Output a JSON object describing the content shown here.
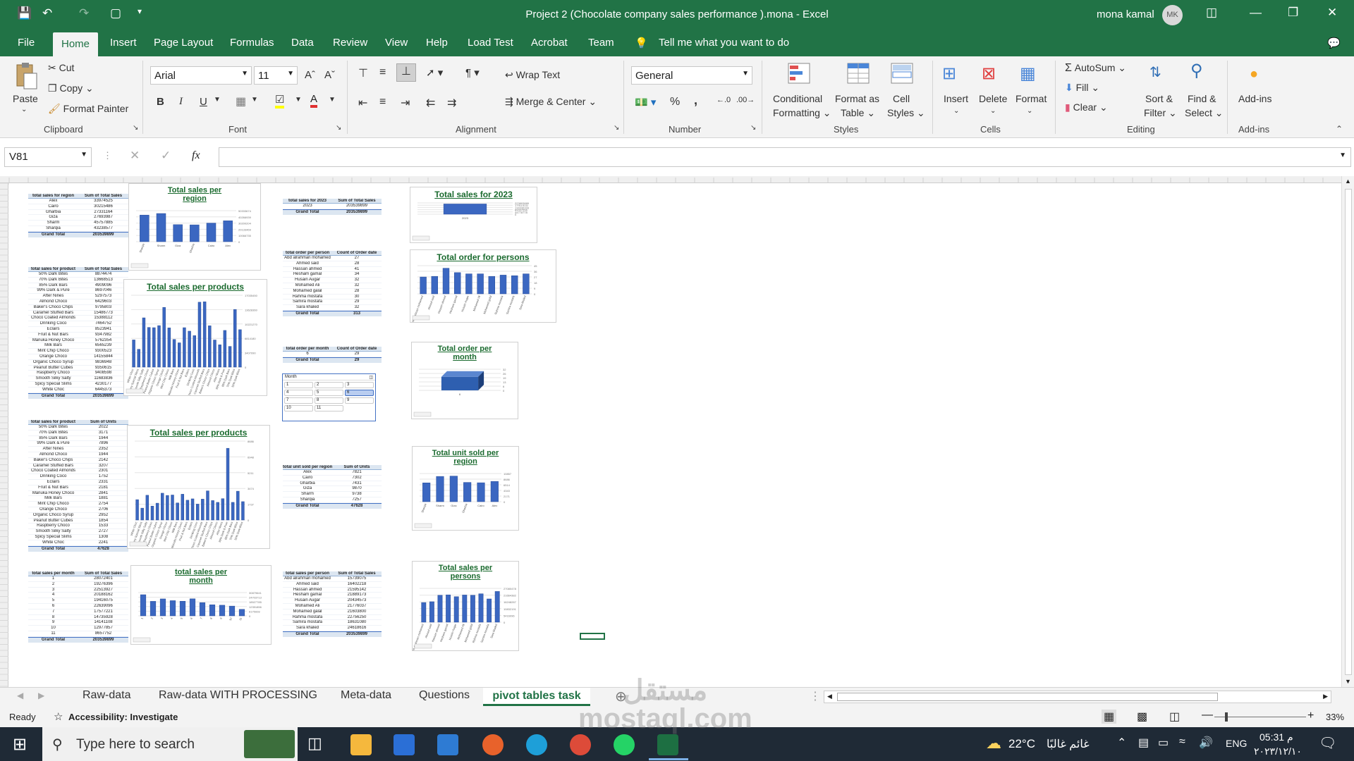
{
  "window": {
    "title": "Project 2 (Chocolate company sales performance ).mona  -  Excel",
    "user": "mona kamal",
    "avatar": "MK"
  },
  "menu": [
    "File",
    "Home",
    "Insert",
    "Page Layout",
    "Formulas",
    "Data",
    "Review",
    "View",
    "Help",
    "Load Test",
    "Acrobat",
    "Team"
  ],
  "tell_me": "Tell me what you want to do",
  "ribbon": {
    "clipboard": {
      "paste": "Paste",
      "cut": "Cut",
      "copy": "Copy",
      "format_painter": "Format Painter",
      "label": "Clipboard"
    },
    "font": {
      "name": "Arial",
      "size": "11",
      "label": "Font",
      "bold": "B",
      "italic": "I",
      "underline": "U"
    },
    "alignment": {
      "wrap": "Wrap Text",
      "merge": "Merge & Center",
      "label": "Alignment"
    },
    "number": {
      "format": "General",
      "label": "Number",
      "percent": "%",
      "comma": ","
    },
    "styles": {
      "conditional": "Conditional",
      "formatting": "Formatting",
      "format_as": "Format as",
      "table": "Table",
      "cell": "Cell",
      "cell_styles": "Styles",
      "label": "Styles"
    },
    "cells": {
      "insert": "Insert",
      "delete": "Delete",
      "format": "Format",
      "label": "Cells"
    },
    "editing": {
      "autosum": "AutoSum",
      "fill": "Fill",
      "clear": "Clear",
      "sort": "Sort &",
      "filter": "Filter",
      "find": "Find &",
      "select": "Select",
      "label": "Editing"
    },
    "addins": {
      "button": "Add-ins",
      "label": "Add-ins"
    }
  },
  "formula_bar": {
    "name_box": "V81",
    "fx": "fx"
  },
  "sheets": [
    "Raw-data",
    "Raw-data WITH PROCESSING",
    "Meta-data",
    "Questions",
    "pivot tables task"
  ],
  "active_sheet": "pivot tables task",
  "status": {
    "ready": "Ready",
    "accessibility": "Accessibility: Investigate",
    "zoom": "33%"
  },
  "taskbar": {
    "search": "Type here to search",
    "weather": "22°C",
    "weather_text": "غائم غالبًا",
    "lang": "ENG",
    "time": "05:31 م",
    "date": "٢٠٢٣/١٢/١٠"
  },
  "watermark": "مستقل\nmostaql.com",
  "pivots": {
    "region_sales": {
      "h1": "total sales for region",
      "h2": "Sum of Total Sales",
      "rows": [
        [
          "Alex",
          "33974525"
        ],
        [
          "Cairo",
          "30215486"
        ],
        [
          "Gharbia",
          "27331164"
        ],
        [
          "Giza",
          "27693987"
        ],
        [
          "Sharm",
          "45757885"
        ],
        [
          "Sharqia",
          "43238577"
        ]
      ],
      "total": [
        "Grand Total",
        "203539899"
      ]
    },
    "product_sales": {
      "h1": "total sales for product",
      "h2": "Sum of Total Sales",
      "rows": [
        [
          "50% Dark Bites",
          "8874474"
        ],
        [
          "70% Dark Bites",
          "13668513"
        ],
        [
          "85% Dark Bars",
          "4909096"
        ],
        [
          "99% Dark & Pure",
          "8697046"
        ],
        [
          "After Nines",
          "5297573"
        ],
        [
          "Almond Choco",
          "6429603"
        ],
        [
          "Baker's Choco Chips",
          "9795803"
        ],
        [
          "Caramel Stuffed Bars",
          "15486773"
        ],
        [
          "Choco Coated Almonds",
          "15388112"
        ],
        [
          "Drinking Coco",
          "7464752"
        ],
        [
          "Eclairs",
          "8523941"
        ],
        [
          "Fruit & Nut Bars",
          "9347982"
        ],
        [
          "Manuka Honey Choco",
          "5762354"
        ],
        [
          "Milk Bars",
          "6565239"
        ],
        [
          "Mint Chip Choco",
          "9300523"
        ],
        [
          "Orange Choco",
          "14155844"
        ],
        [
          "Organic Choco Syrup",
          "9836948"
        ],
        [
          "Peanut Butter Cubes",
          "9350615"
        ],
        [
          "Raspberry Choco",
          "9408598"
        ],
        [
          "Smooth Silky Salty",
          "11683836"
        ],
        [
          "Spicy Special Slims",
          "4230177"
        ],
        [
          "White Choc",
          "6445373"
        ]
      ],
      "total": [
        "Grand Total",
        "203539899"
      ]
    },
    "product_units": {
      "h1": "total sales for product",
      "h2": "Sum of Units",
      "rows": [
        [
          "50% Dark Bites",
          "2022"
        ],
        [
          "70% Dark Bites",
          "3171"
        ],
        [
          "85% Dark Bars",
          "1944"
        ],
        [
          "99% Dark & Pure",
          "7896"
        ],
        [
          "After Nines",
          "2352"
        ],
        [
          "Almond Choco",
          "1944"
        ],
        [
          "Baker's Choco Chips",
          "2142"
        ],
        [
          "Caramel Stuffed Bars",
          "3207"
        ],
        [
          "Choco Coated Almonds",
          "2301"
        ],
        [
          "Drinking Coco",
          "1752"
        ],
        [
          "Eclairs",
          "2331"
        ],
        [
          "Fruit & Nut Bars",
          "2181"
        ],
        [
          "Manuka Honey Choco",
          "2841"
        ],
        [
          "Milk Bars",
          "1881"
        ],
        [
          "Mint Chip Choco",
          "2754"
        ],
        [
          "Orange Choco",
          "2706"
        ],
        [
          "Organic Choco Syrup",
          "2952"
        ],
        [
          "Peanut Butter Cubes",
          "1854"
        ],
        [
          "Raspberry Choco",
          "1533"
        ],
        [
          "Smooth Silky Salty",
          "2727"
        ],
        [
          "Spicy Special Slims",
          "1308"
        ],
        [
          "White Choc",
          "2241"
        ]
      ],
      "total": [
        "Grand Total",
        "47628"
      ]
    },
    "month_sales": {
      "h1": "total sales per month",
      "h2": "Sum of Total Sales",
      "rows": [
        [
          "1",
          "28072401"
        ],
        [
          "2",
          "19276396"
        ],
        [
          "3",
          "22513927"
        ],
        [
          "4",
          "20188162"
        ],
        [
          "5",
          "19416075"
        ],
        [
          "6",
          "22639096"
        ],
        [
          "7",
          "17577221"
        ],
        [
          "8",
          "14735928"
        ],
        [
          "9",
          "14141108"
        ],
        [
          "10",
          "12977857"
        ],
        [
          "11",
          "8657752"
        ]
      ],
      "total": [
        "Grand Total",
        "203539899"
      ]
    },
    "year_sales": {
      "h1": "total sales for 2023",
      "h2": "Sum of Total Sales",
      "rows": [
        [
          "2023",
          "203539899"
        ]
      ],
      "total": [
        "Grand Total",
        "203539899"
      ]
    },
    "person_orders": {
      "h1": "total order per person",
      "h2": "Count of Order date",
      "rows": [
        [
          "Abd alrahman mohamed",
          "27"
        ],
        [
          "Ahmed said",
          "28"
        ],
        [
          "Hassan ahmed",
          "41"
        ],
        [
          "Hesham gamal",
          "34"
        ],
        [
          "Husain Augar",
          "32"
        ],
        [
          "Mohamed Ali",
          "32"
        ],
        [
          "Mohamed galal",
          "28"
        ],
        [
          "Rahma mostafa",
          "30"
        ],
        [
          "Samira mostafa",
          "29"
        ],
        [
          "Sara khaled",
          "32"
        ]
      ],
      "total": [
        "Grand Total",
        "313"
      ]
    },
    "month_orders": {
      "h1": "total order per month",
      "h2": "Count of Order date",
      "rows": [
        [
          "6",
          "29"
        ]
      ],
      "total": [
        "Grand Total",
        "29"
      ]
    },
    "region_units": {
      "h1": "total unit sold per region",
      "h2": "Sum of Units",
      "rows": [
        [
          "Alex",
          "7821"
        ],
        [
          "Cairo",
          "7302"
        ],
        [
          "Gharbia",
          "7431"
        ],
        [
          "Giza",
          "9870"
        ],
        [
          "Sharm",
          "9738"
        ],
        [
          "Sharqia",
          "7257"
        ]
      ],
      "total": [
        "Grand Total",
        "47628"
      ]
    },
    "person_sales": {
      "h1": "total sales per person",
      "h2": "Sum of Total Sales",
      "rows": [
        [
          "Abd alrahman mohamed",
          "15739075"
        ],
        [
          "Ahmed said",
          "16402218"
        ],
        [
          "Hassan ahmed",
          "21595142"
        ],
        [
          "Hesham gamal",
          "21889173"
        ],
        [
          "Husain Augar",
          "20434573"
        ],
        [
          "Mohamed Ali",
          "21776037"
        ],
        [
          "Mohamed galal",
          "21603800"
        ],
        [
          "Rahma mostafa",
          "22756250"
        ],
        [
          "Samira mostafa",
          "18631080"
        ],
        [
          "Sara khaled",
          "24618616"
        ]
      ],
      "total": [
        "Grand Total",
        "203539899"
      ]
    }
  },
  "slicer": {
    "title": "Month",
    "items": [
      "1",
      "2",
      "3",
      "4",
      "5",
      "6",
      "7",
      "8",
      "9",
      "10",
      "11"
    ],
    "selected": "6"
  },
  "chart_data": [
    {
      "type": "bar",
      "title": "Total sales per region",
      "categories": [
        "Sharqia",
        "Sharm",
        "Giza",
        "Gharbia",
        "Cairo",
        "Alex"
      ],
      "values": [
        43238577,
        45757885,
        27693987,
        27331164,
        30215486,
        33974525
      ]
    },
    {
      "type": "bar",
      "title": "Total sales per products",
      "categories": [
        "White Choc",
        "Spicy Special Slims",
        "Smooth Silky Salty",
        "Raspberry Choco",
        "Peanut Butter Cubes",
        "Organic Choco Syrup",
        "Orange Choco",
        "Mint Chip Choco",
        "Milk Bars",
        "Manuka Honey Choco",
        "Fruit & Nut Bars",
        "Eclairs",
        "Drinking Coco",
        "Choco Coated Almonds",
        "Caramel Stuffed Bars",
        "Baker's Choco Chips",
        "Almond Choco",
        "After Nines",
        "99% Dark & Pure",
        "85% Dark Bars",
        "70% Dark Bites",
        "50% Dark Bites"
      ],
      "values": [
        6445373,
        4230177,
        11683836,
        9408598,
        9350615,
        9836948,
        14155844,
        9300523,
        6565239,
        5762354,
        9347982,
        8523941,
        7464752,
        15388112,
        15486773,
        9795803,
        6429603,
        5297573,
        8697046,
        4909096,
        13668513,
        8874474
      ]
    },
    {
      "type": "bar",
      "title": "Total sales per products",
      "categories": [
        "White Choc",
        "Spicy Special Slims",
        "Smooth Silky Salty",
        "Raspberry Choco",
        "Peanut Butter Cubes",
        "Organic Choco Syrup",
        "Orange Choco",
        "Mint Chip Choco",
        "Milk Bars",
        "Manuka Honey Choco",
        "Fruit & Nut Bars",
        "Eclairs",
        "Drinking Coco",
        "Choco Coated Almonds",
        "Caramel Stuffed Bars",
        "Baker's Choco Chips",
        "Almond Choco",
        "After Nines",
        "99% Dark & Pure",
        "85% Dark Bars",
        "70% Dark Bites",
        "50% Dark Bites"
      ],
      "values": [
        2241,
        1308,
        2727,
        1533,
        1854,
        2952,
        2706,
        2754,
        1881,
        2841,
        2181,
        2331,
        1752,
        2301,
        3207,
        2142,
        1944,
        2352,
        7896,
        1944,
        3171,
        2022
      ]
    },
    {
      "type": "bar",
      "title": "total sales per month",
      "categories": [
        "1",
        "2",
        "3",
        "4",
        "5",
        "6",
        "7",
        "8",
        "9",
        "10",
        "11"
      ],
      "values": [
        28072401,
        19276396,
        22513927,
        20188162,
        19416075,
        22639096,
        17577221,
        14735928,
        14141108,
        12977857,
        8657752
      ]
    },
    {
      "type": "bar",
      "title": "Total sales for 2023",
      "categories": [
        "2023"
      ],
      "values": [
        203539899
      ]
    },
    {
      "type": "bar",
      "title": "Total order for persons",
      "categories": [
        "Abd alrahman mohamed",
        "Ahmed said",
        "Hassan ahmed",
        "Hesham gamal",
        "Husain Augar",
        "Mohamed Ali",
        "Mohamed galal",
        "Rahma mostafa",
        "Samira mostafa",
        "Sara khaled"
      ],
      "values": [
        27,
        28,
        41,
        34,
        32,
        32,
        28,
        30,
        29,
        32
      ]
    },
    {
      "type": "bar",
      "title": "Total order per month",
      "categories": [
        "6"
      ],
      "values": [
        29
      ]
    },
    {
      "type": "bar",
      "title": "Total unit sold per region",
      "categories": [
        "Sharqia",
        "Sharm",
        "Giza",
        "Gharbia",
        "Cairo",
        "Alex"
      ],
      "values": [
        7257,
        9738,
        9870,
        7431,
        7302,
        7821
      ]
    },
    {
      "type": "bar",
      "title": "Total sales per persons",
      "categories": [
        "Abd alrahman mohamed",
        "Ahmed said",
        "Hassan ahmed",
        "Hesham gamal",
        "Husain Augar",
        "Mohamed Ali",
        "Mohamed galal",
        "Rahma mostafa",
        "Samira mostafa",
        "Sara khaled"
      ],
      "values": [
        15739075,
        16402218,
        21595142,
        21889173,
        20434573,
        21776037,
        21603800,
        22756250,
        18631080,
        24618616
      ]
    }
  ]
}
